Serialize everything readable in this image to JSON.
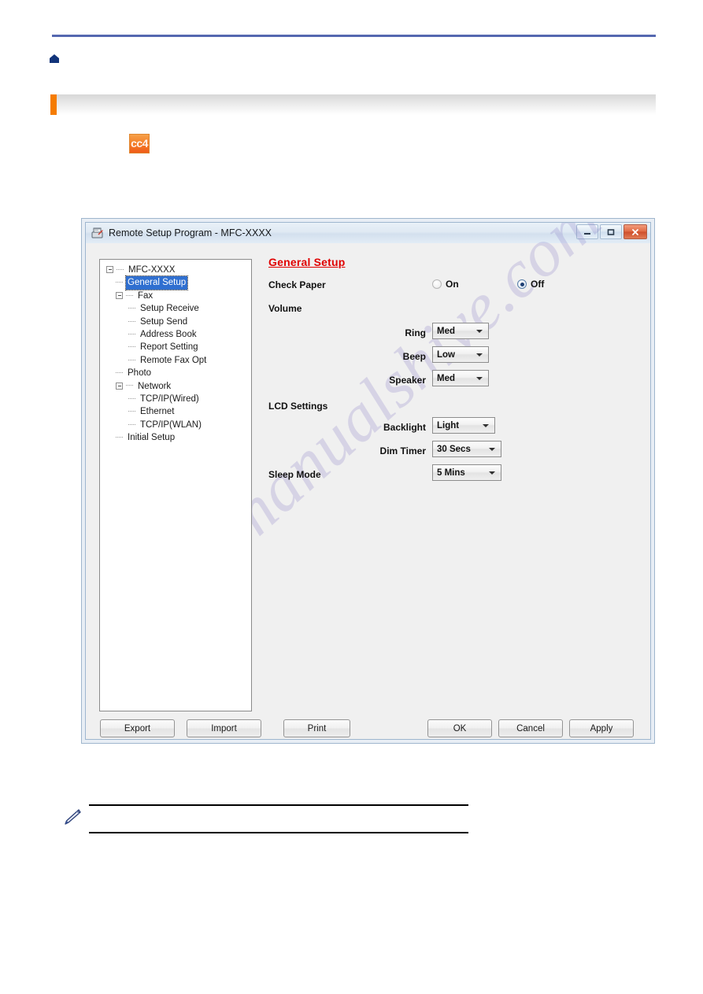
{
  "page": {
    "home_icon": "home-icon",
    "note_icon": "note-pencil-icon",
    "app_icon_label": "cc4",
    "watermark": "manualshive.com",
    "accent_orange": "#f57c00",
    "rule_blue": "#5568b0"
  },
  "dialog": {
    "title": "Remote Setup Program - MFC-XXXX",
    "title_icon": "remote-setup-icon",
    "window_controls": {
      "minimize": "minimize-icon",
      "maximize": "maximize-icon",
      "close": "close-icon"
    }
  },
  "tree": {
    "items": [
      {
        "label": "MFC-XXXX",
        "level": 0,
        "expander": "minus",
        "selected": false
      },
      {
        "label": "General Setup",
        "level": 1,
        "expander": "leaf",
        "selected": true
      },
      {
        "label": "Fax",
        "level": 1,
        "expander": "minus",
        "selected": false
      },
      {
        "label": "Setup Receive",
        "level": 2,
        "expander": "leaf",
        "selected": false
      },
      {
        "label": "Setup Send",
        "level": 2,
        "expander": "leaf",
        "selected": false
      },
      {
        "label": "Address Book",
        "level": 2,
        "expander": "leaf",
        "selected": false
      },
      {
        "label": "Report Setting",
        "level": 2,
        "expander": "leaf",
        "selected": false
      },
      {
        "label": "Remote Fax Opt",
        "level": 2,
        "expander": "leaf",
        "selected": false
      },
      {
        "label": "Photo",
        "level": 1,
        "expander": "leaf",
        "selected": false
      },
      {
        "label": "Network",
        "level": 1,
        "expander": "minus",
        "selected": false
      },
      {
        "label": "TCP/IP(Wired)",
        "level": 2,
        "expander": "leaf",
        "selected": false
      },
      {
        "label": "Ethernet",
        "level": 2,
        "expander": "leaf",
        "selected": false
      },
      {
        "label": "TCP/IP(WLAN)",
        "level": 2,
        "expander": "leaf",
        "selected": false
      },
      {
        "label": "Initial Setup",
        "level": 1,
        "expander": "leaf",
        "selected": false
      }
    ]
  },
  "pane": {
    "section_title": "General Setup",
    "check_paper": {
      "label": "Check Paper",
      "on_label": "On",
      "off_label": "Off",
      "selected": "Off"
    },
    "volume": {
      "label": "Volume",
      "ring": {
        "label": "Ring",
        "value": "Med"
      },
      "beep": {
        "label": "Beep",
        "value": "Low"
      },
      "speaker": {
        "label": "Speaker",
        "value": "Med"
      }
    },
    "lcd": {
      "label": "LCD Settings",
      "backlight": {
        "label": "Backlight",
        "value": "Light"
      },
      "dim_timer": {
        "label": "Dim Timer",
        "value": "30 Secs"
      }
    },
    "sleep_mode": {
      "label": "Sleep Mode",
      "value": "5 Mins"
    }
  },
  "buttons": {
    "export": "Export",
    "import": "Import",
    "print": "Print",
    "ok": "OK",
    "cancel": "Cancel",
    "apply": "Apply"
  }
}
